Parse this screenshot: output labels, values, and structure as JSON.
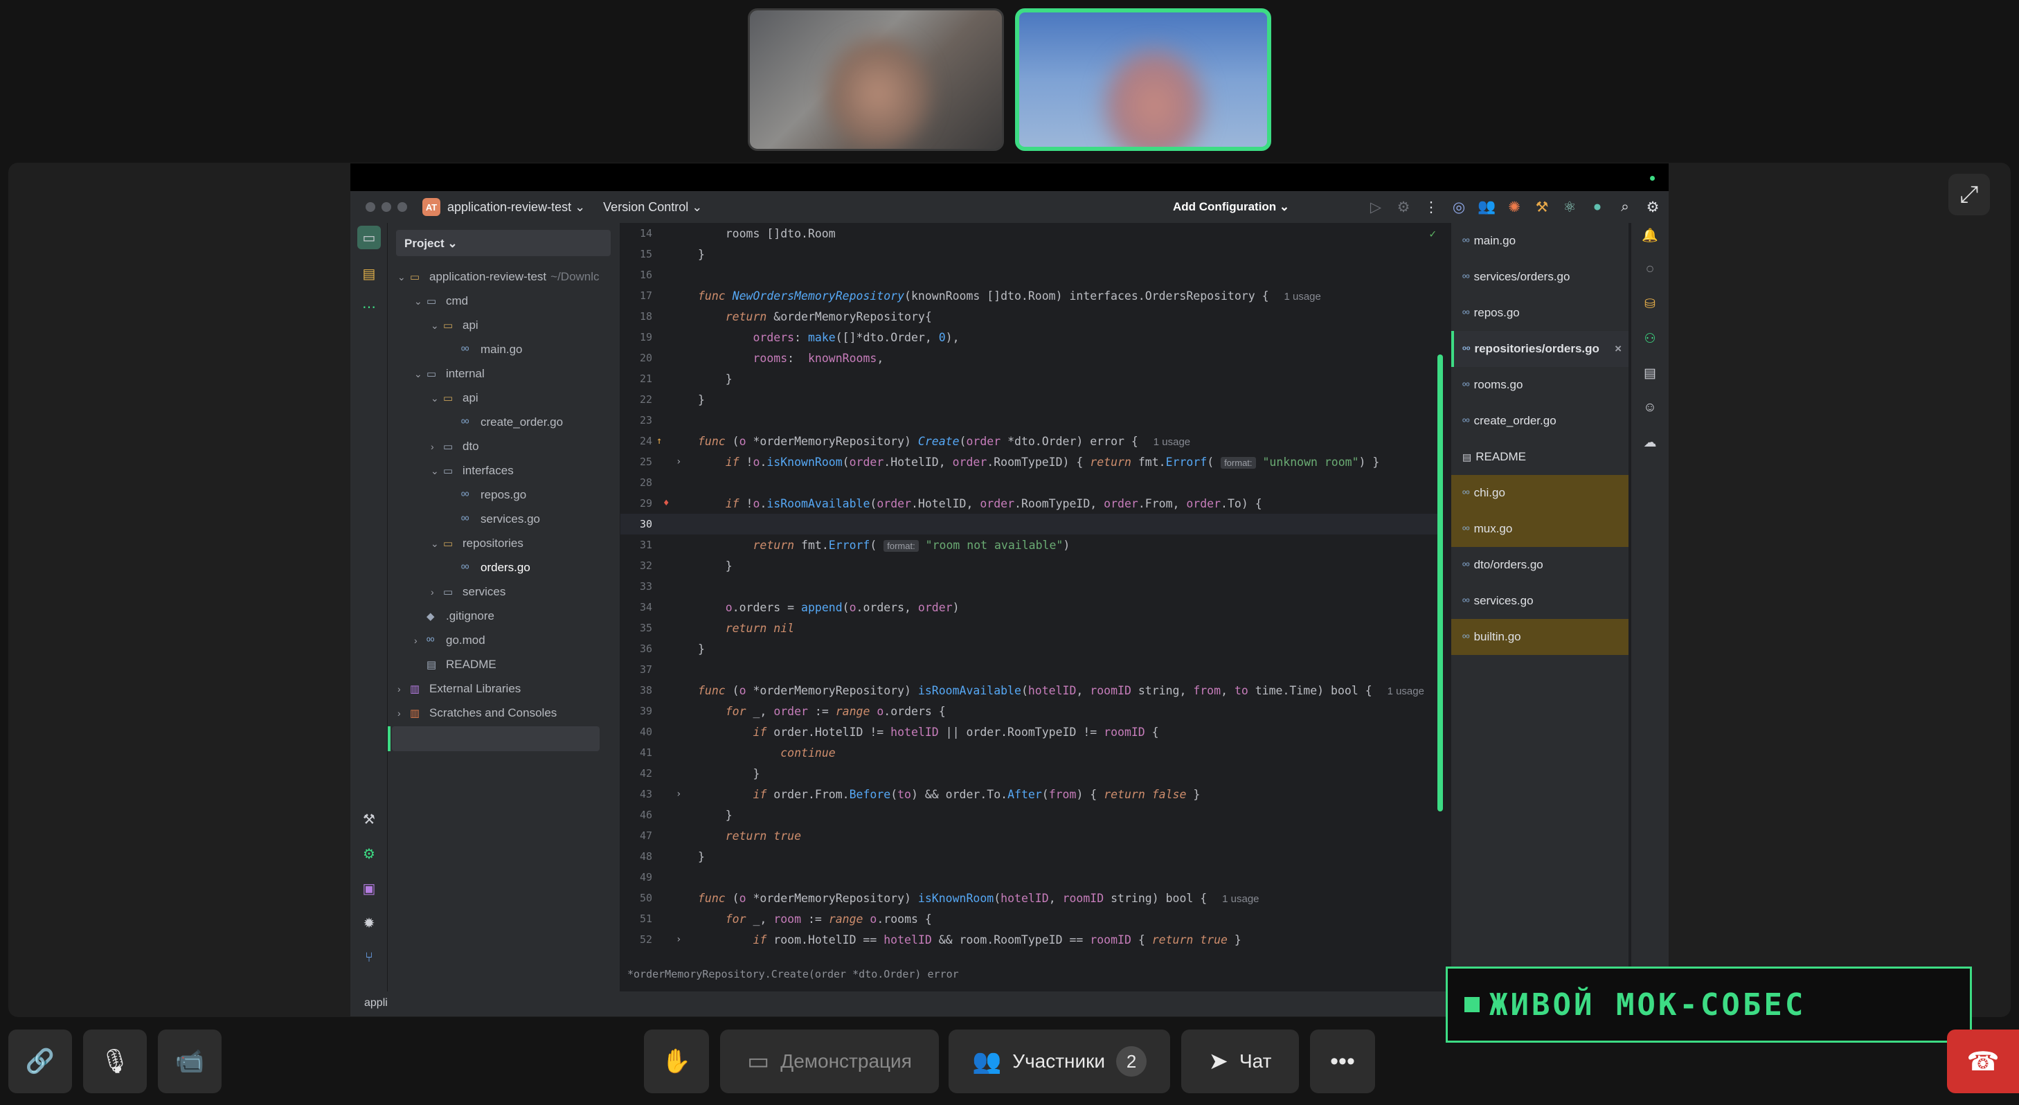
{
  "ide": {
    "project_badge": "AT",
    "project_name": "application-review-test",
    "vcs": "Version Control",
    "add_config": "Add Configuration",
    "project_header": "Project",
    "tree": [
      {
        "label": "application-review-test",
        "dim": "~/Downlc"
      },
      {
        "label": "cmd"
      },
      {
        "label": "api"
      },
      {
        "label": "main.go"
      },
      {
        "label": "internal"
      },
      {
        "label": "api"
      },
      {
        "label": "create_order.go"
      },
      {
        "label": "dto"
      },
      {
        "label": "interfaces"
      },
      {
        "label": "repos.go"
      },
      {
        "label": "services.go"
      },
      {
        "label": "repositories"
      },
      {
        "label": "orders.go"
      },
      {
        "label": "services"
      },
      {
        "label": ".gitignore"
      },
      {
        "label": "go.mod"
      },
      {
        "label": "README"
      },
      {
        "label": "External Libraries"
      },
      {
        "label": "Scratches and Consoles"
      }
    ],
    "line_numbers": [
      "14",
      "15",
      "16",
      "17",
      "18",
      "19",
      "20",
      "21",
      "22",
      "23",
      "24",
      "25",
      "28",
      "29",
      "30",
      "31",
      "32",
      "33",
      "34",
      "35",
      "36",
      "37",
      "38",
      "39",
      "40",
      "41",
      "42",
      "43",
      "46",
      "47",
      "48",
      "49",
      "50",
      "51",
      "52"
    ],
    "usage_label": "1 usage",
    "format_hint": "format:",
    "strings": {
      "unknown_room": "\"unknown room\"",
      "room_not_available": "\"room not available\""
    },
    "breadcrumb": "*orderMemoryRepository.Create(order *dto.Order) error",
    "status": "appli",
    "open_files": [
      {
        "label": "main.go"
      },
      {
        "label": "services/orders.go"
      },
      {
        "label": "repos.go"
      },
      {
        "label": "repositories/orders.go"
      },
      {
        "label": "rooms.go"
      },
      {
        "label": "create_order.go"
      },
      {
        "label": "README"
      },
      {
        "label": "chi.go"
      },
      {
        "label": "mux.go"
      },
      {
        "label": "dto/orders.go"
      },
      {
        "label": "services.go"
      },
      {
        "label": "builtin.go"
      }
    ]
  },
  "banner": "ЖИВОЙ МОК-СОБЕС",
  "controls": {
    "demo": "Демонстрация",
    "participants": "Участники",
    "participants_count": "2",
    "chat": "Чат"
  },
  "colors": {
    "accent": "#3ddc84",
    "end_call": "#d0312d"
  }
}
